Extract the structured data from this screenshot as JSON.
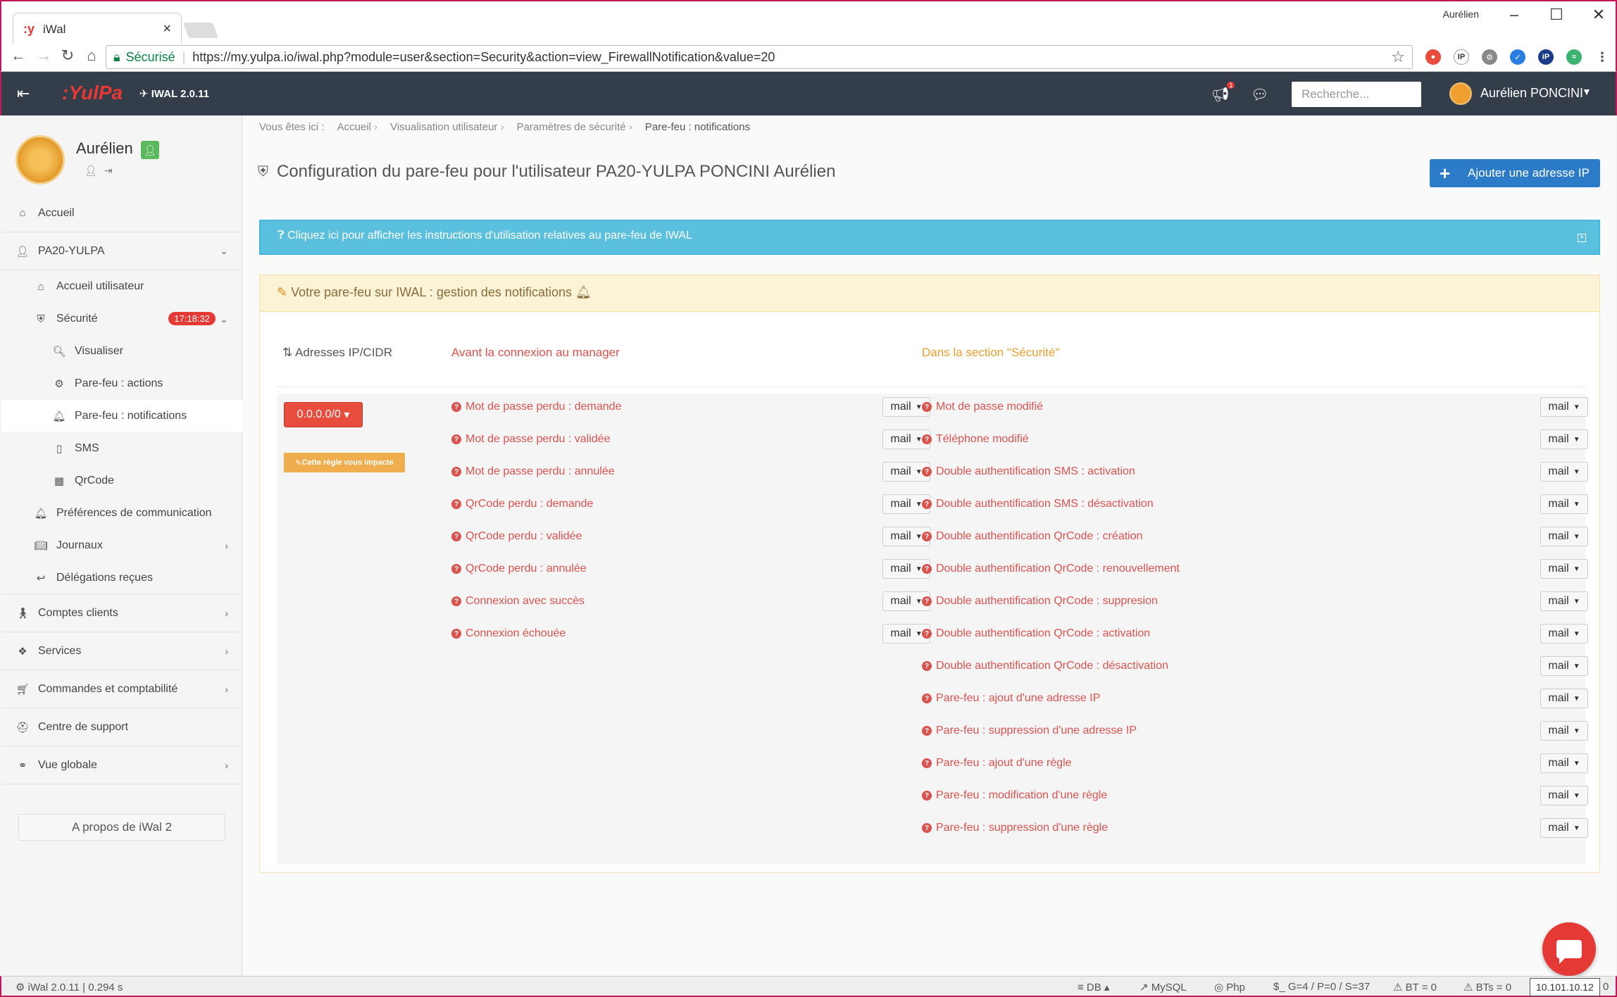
{
  "browser": {
    "tab_title": "iWal",
    "tab_icon": ":y",
    "window_user": "Aurélien",
    "url_secure_label": "Sécurisé",
    "url": "https://my.yulpa.io/iwal.php?module=user&section=Security&action=view_FirewallNotification&value=20"
  },
  "header": {
    "logo": ":YulPa",
    "version": "IWAL 2.0.11",
    "notif_count": "1",
    "search_placeholder": "Recherche...",
    "username": "Aurélien PONCINI"
  },
  "sidebar": {
    "profile_name": "Aurélien",
    "items": [
      {
        "label": "Accueil",
        "icon": "home-icon"
      },
      {
        "label": "PA20-YULPA",
        "icon": "user-icon"
      },
      {
        "label": "Accueil utilisateur",
        "icon": "home-icon"
      },
      {
        "label": "Sécurité",
        "icon": "shield-icon",
        "badge": "17:18:32"
      },
      {
        "label": "Visualiser",
        "icon": "search-icon"
      },
      {
        "label": "Pare-feu : actions",
        "icon": "gears-icon"
      },
      {
        "label": "Pare-feu : notifications",
        "icon": "bell-icon"
      },
      {
        "label": "SMS",
        "icon": "mobile-icon"
      },
      {
        "label": "QrCode",
        "icon": "qrcode-icon"
      },
      {
        "label": "Préférences de communication",
        "icon": "bell-icon"
      },
      {
        "label": "Journaux",
        "icon": "book-icon"
      },
      {
        "label": "Délégations reçues",
        "icon": "reply-icon"
      },
      {
        "label": "Comptes clients",
        "icon": "child-icon"
      },
      {
        "label": "Services",
        "icon": "cubes-icon"
      },
      {
        "label": "Commandes et comptabilité",
        "icon": "cart-icon"
      },
      {
        "label": "Centre de support",
        "icon": "medkit-icon"
      },
      {
        "label": "Vue globale",
        "icon": "binoculars-icon"
      }
    ],
    "about": "A propos de iWal 2"
  },
  "breadcrumb": {
    "prefix": "Vous êtes ici :",
    "items": [
      "Accueil",
      "Visualisation utilisateur",
      "Paramètres de sécurité",
      "Pare-feu : notifications"
    ]
  },
  "page": {
    "title": "Configuration du pare-feu pour l'utilisateur PA20-YULPA PONCINI Aurélien",
    "add_button": "Ajouter une adresse IP",
    "info": "Cliquez ici pour afficher les instructions d'utilisation relatives au pare-feu de IWAL",
    "panel_title": "Votre pare-feu sur IWAL : gestion des notifications"
  },
  "table": {
    "col_ip": "Adresses IP/CIDR",
    "col_before": "Avant la connexion au manager",
    "col_section": "Dans la section \"Sécurité\"",
    "ip": "0.0.0.0/0",
    "impact": "Cette règle vous impacte",
    "mail_label": "mail",
    "before": [
      "Mot de passe perdu : demande",
      "Mot de passe perdu : validée",
      "Mot de passe perdu : annulée",
      "QrCode perdu : demande",
      "QrCode perdu : validée",
      "QrCode perdu : annulée",
      "Connexion avec succès",
      "Connexion échouée"
    ],
    "section": [
      "Mot de passe modifié",
      "Téléphone modifié",
      "Double authentification SMS : activation",
      "Double authentification SMS : désactivation",
      "Double authentification QrCode : création",
      "Double authentification QrCode : renouvellement",
      "Double authentification QrCode : suppresion",
      "Double authentification QrCode : activation",
      "Double authentification QrCode : désactivation",
      "Pare-feu : ajout d'une adresse IP",
      "Pare-feu : suppression d'une adresse IP",
      "Pare-feu : ajout d'une règle",
      "Pare-feu : modification d'une règle",
      "Pare-feu : suppression d'une règle"
    ]
  },
  "statusbar": {
    "left": "iWal 2.0.11 | 0.294 s",
    "db": "DB",
    "mysql": "MySQL",
    "php": "Php",
    "counts": "$_ G=4 / P=0 / S=37",
    "bt": "BT = 0",
    "bts": "BTs = 0",
    "ip": "10.101.10.12",
    "last": "0"
  }
}
